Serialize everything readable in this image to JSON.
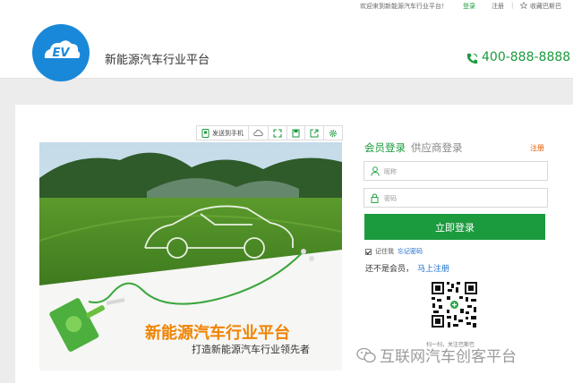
{
  "topbar": {
    "welcome": "欢迎来到新能源汽车行业平台！",
    "login": "登录",
    "register": "注册",
    "separator": "|",
    "favorite": "收藏巴斯巴"
  },
  "header": {
    "logo_text": "EV",
    "site_title": "新能源汽车行业平台",
    "hotline": "400-888-8888"
  },
  "toolbar": {
    "send_to_phone": "发送到手机"
  },
  "banner": {
    "title": "新能源汽车行业平台",
    "subtitle": "打造新能源汽车行业领先者"
  },
  "login": {
    "tab_member": "会员登录",
    "tab_supplier": "供应商登录",
    "register": "注册",
    "username_placeholder": "昵称",
    "password_placeholder": "密码",
    "submit": "立即登录",
    "remember": "记住我",
    "forgot": "忘记密码",
    "not_member": "还不是会员，",
    "signup": "马上注册",
    "qr_caption": "扫一扫，关注巴斯巴"
  },
  "watermark": {
    "text": "互联网汽车创客平台"
  },
  "colors": {
    "brand_green": "#1c9a3e",
    "accent_orange": "#f08300",
    "link_blue": "#1a6ec9",
    "logo_blue": "#1a88d8"
  }
}
